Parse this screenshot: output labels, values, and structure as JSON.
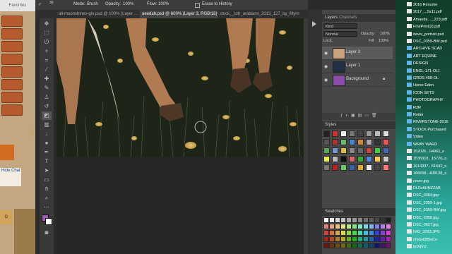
{
  "browser": {
    "tab_label": "Favorites",
    "chat_text": "Hide Chat",
    "sign_text": "D",
    "bookmark_count": 8
  },
  "options": {
    "brush_size": "30",
    "mode_label": "Mode:",
    "mode_value": "Brush",
    "opacity_label": "Opacity:",
    "opacity_value": "100%",
    "flow_label": "Flow:",
    "flow_value": "100%",
    "erase_history": "Erase to History"
  },
  "tabs": [
    {
      "label": "all-moonshines-glo.psd @ 100% (Layer …"
    },
    {
      "label": "aeedah.psd @ 600% (Layer 3, RGB/16)"
    },
    {
      "label": "stock__totr_arabians_2013_127_by_fillyrn"
    }
  ],
  "layers_panel": {
    "tab_layers": "Layers",
    "tab_channels": "Channels",
    "kind": "Kind",
    "blend": "Normal",
    "opacity_label": "Opacity:",
    "opacity": "100%",
    "lock_label": "Lock:",
    "fill_label": "Fill:",
    "fill": "100%",
    "layers": [
      {
        "name": "Layer 3"
      },
      {
        "name": "Layer 1"
      },
      {
        "name": "Background"
      }
    ]
  },
  "styles_panel": {
    "title": "Styles"
  },
  "swatches_panel": {
    "title": "Swatches"
  },
  "colors": {
    "accent": "#8a4ea8",
    "foreground": "#a05ab8",
    "background": "#ffffff",
    "desktop_top": "#0f3e2a",
    "desktop_bottom": "#3cc0b0"
  },
  "desktop_items": [
    {
      "label": "2016 Resume",
      "kind": "file"
    },
    {
      "label": "2017_...5s11.pdf",
      "kind": "file"
    },
    {
      "label": "Amanda...._223.pdf",
      "kind": "file"
    },
    {
      "label": "FinePrint(2).pdf",
      "kind": "file"
    },
    {
      "label": "davis_portrait.psd",
      "kind": "file"
    },
    {
      "label": "DSC_0359-BW.psd",
      "kind": "file"
    },
    {
      "label": "ARCHIVE SCAD",
      "kind": "folder"
    },
    {
      "label": "ART EQUINE",
      "kind": "folder"
    },
    {
      "label": "DESIGN",
      "kind": "folder"
    },
    {
      "label": "ENGL-171-OL1",
      "kind": "folder"
    },
    {
      "label": "GRDS-408-OL",
      "kind": "folder"
    },
    {
      "label": "Horse Eden",
      "kind": "folder"
    },
    {
      "label": "ICON SETS",
      "kind": "folder"
    },
    {
      "label": "PHOTOGRAPHY",
      "kind": "folder"
    },
    {
      "label": "R2R",
      "kind": "folder"
    },
    {
      "label": "Reiter",
      "kind": "folder"
    },
    {
      "label": "RIVERSTONE-2016",
      "kind": "folder"
    },
    {
      "label": "STOCK Purchased",
      "kind": "folder"
    },
    {
      "label": "Video",
      "kind": "folder"
    },
    {
      "label": "WRAY WARD",
      "kind": "folder"
    },
    {
      "label": "152026...04962_n",
      "kind": "file"
    },
    {
      "label": "1536918...15726_o",
      "kind": "file"
    },
    {
      "label": "1614337...51632_n",
      "kind": "file"
    },
    {
      "label": "166658...408138_o",
      "kind": "file"
    },
    {
      "label": "cover.jpg",
      "kind": "file"
    },
    {
      "label": "DLRz5HNZZAB",
      "kind": "file"
    },
    {
      "label": "DSC_0084.jpg",
      "kind": "file"
    },
    {
      "label": "DSC_0359-1.jpg",
      "kind": "file"
    },
    {
      "label": "DSC_0359-BW.jpg",
      "kind": "file"
    },
    {
      "label": "DSC_0359.jpg",
      "kind": "file"
    },
    {
      "label": "DSC_0627.jpg",
      "kind": "file"
    },
    {
      "label": "IMG_3263.JPG",
      "kind": "file"
    },
    {
      "label": "nfaGd385sCo",
      "kind": "file"
    },
    {
      "label": "tpIXjVU",
      "kind": "file"
    }
  ]
}
